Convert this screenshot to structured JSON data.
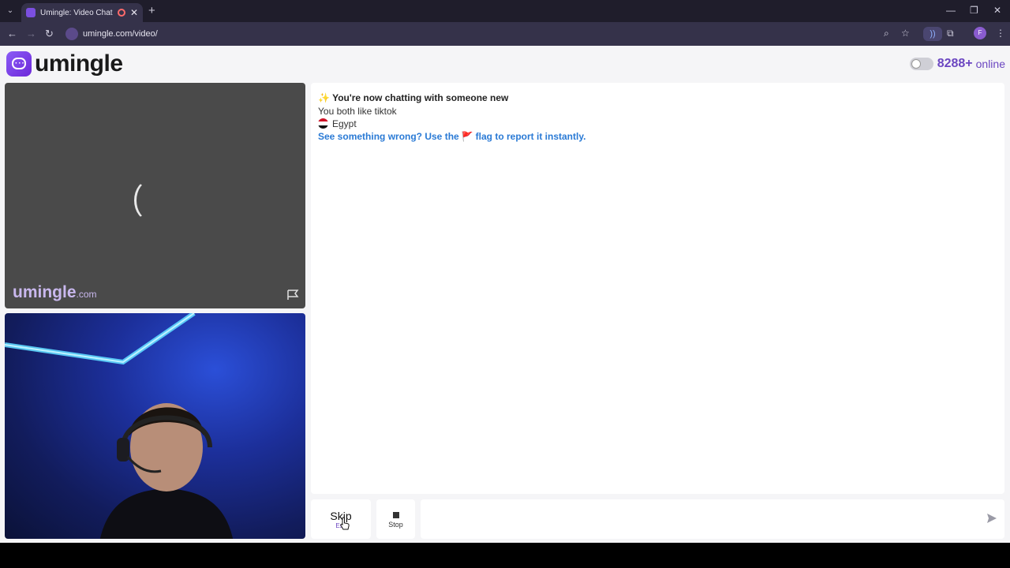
{
  "browser": {
    "tab_title": "Umingle: Video Chat with S",
    "close_symbol": "✕",
    "new_tab_symbol": "+",
    "url": "umingle.com/video/",
    "profile_initial": "F"
  },
  "header": {
    "logo_text": "umingle",
    "online_count": "8288+",
    "online_label": "online"
  },
  "partner_video": {
    "watermark_main": "umingle",
    "watermark_suffix": ".com"
  },
  "chat": {
    "sparkle": "✨",
    "new_chat_text": "You're now chatting with someone new",
    "likes_text": "You both like tiktok",
    "country": "Egypt",
    "warning_before": "See something wrong? Use the",
    "warning_flag": "🚩",
    "warning_after": "flag to report it instantly."
  },
  "controls": {
    "skip_label": "Skip",
    "skip_hint": "Esc",
    "stop_label": "Stop",
    "message_placeholder": ""
  },
  "colors": {
    "accent": "#6b46c1",
    "link": "#2a7ad5"
  }
}
